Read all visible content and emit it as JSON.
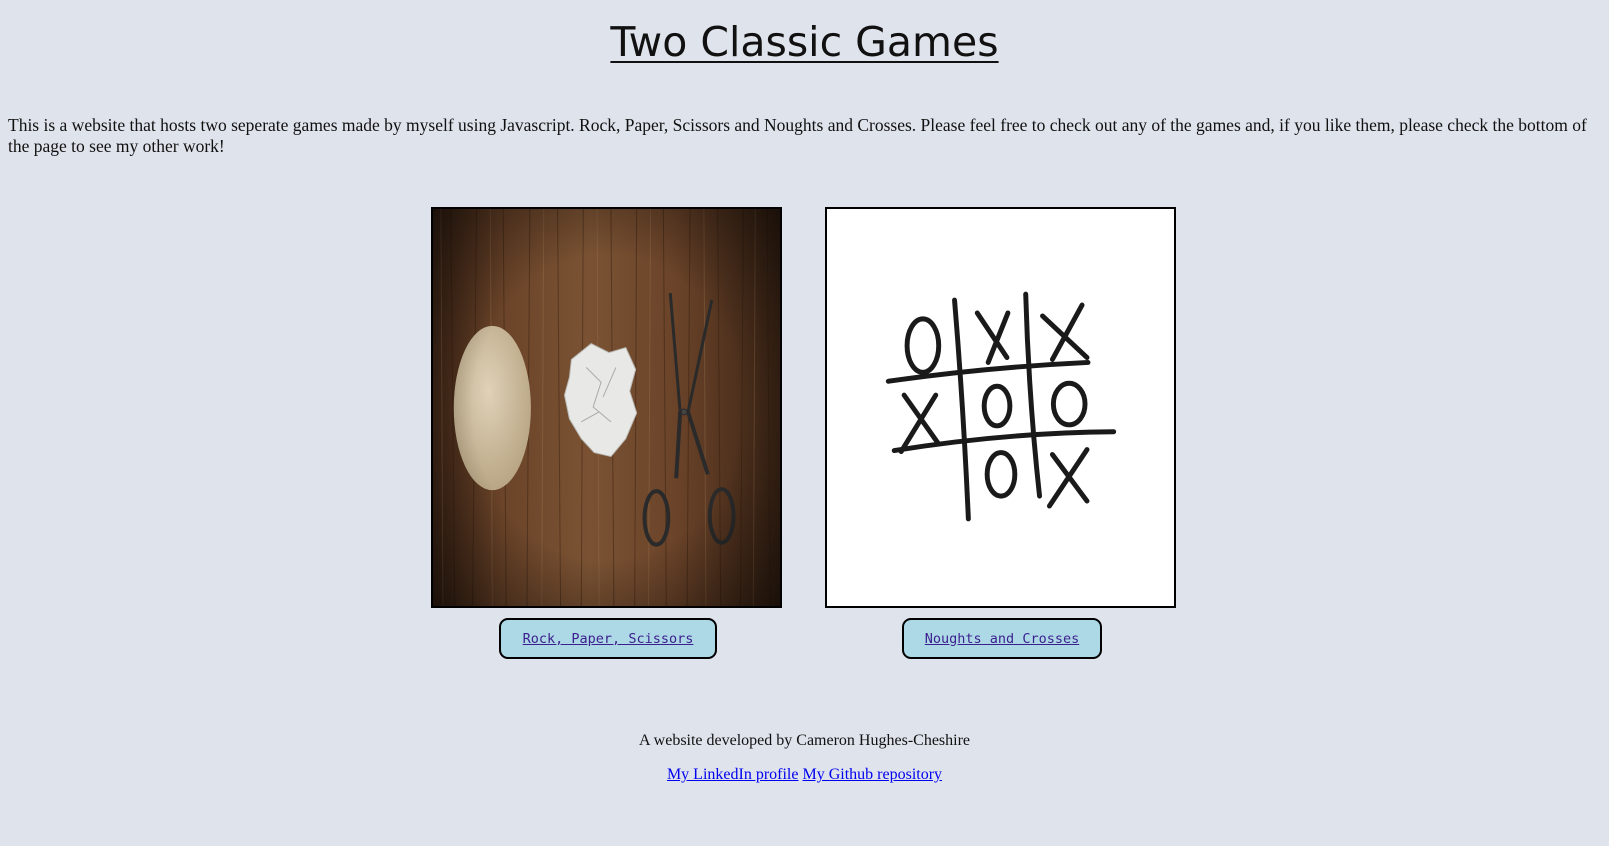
{
  "header": {
    "title": "Two Classic Games"
  },
  "intro": {
    "text": "This is a website that hosts two seperate games made by myself using Javascript. Rock, Paper, Scissors and Noughts and Crosses. Please feel free to check out any of the games and, if you like them, please check the bottom of the page to see my other work!"
  },
  "games": [
    {
      "label": "Rock, Paper, Scissors",
      "image": "rock-paper-scissors-photo"
    },
    {
      "label": "Noughts and Crosses",
      "image": "noughts-and-crosses-grid"
    }
  ],
  "footer": {
    "credit": "A website developed by Cameron Hughes-Cheshire",
    "links": [
      {
        "label": "My LinkedIn profile"
      },
      {
        "label": "My Github repository"
      }
    ]
  },
  "colors": {
    "background": "#dfe3ec",
    "button_bg": "#add8e6",
    "link": "#0000ee"
  }
}
